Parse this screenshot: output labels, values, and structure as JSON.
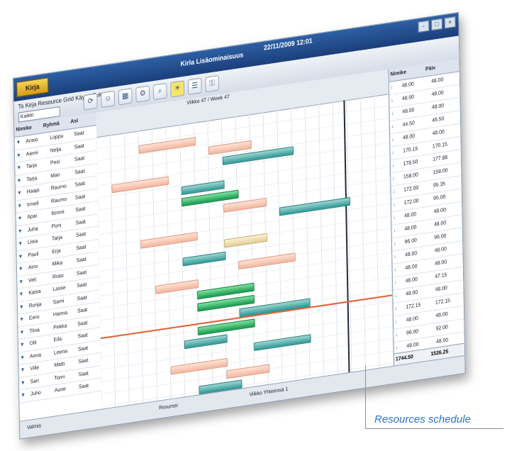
{
  "app": {
    "title": "Kirla Lisäominaisuus",
    "datetime": "22/11/2009 12:01",
    "logo_text": "Kirja",
    "window_buttons": [
      "-",
      "□",
      "×"
    ]
  },
  "toolbar": {
    "menu_text": "Ts Kirja Resource Grid Käyttö Tulos",
    "combo_value": "Kaikki",
    "icons": [
      "refresh-icon",
      "users-icon",
      "calendar-icon",
      "settings-icon",
      "search-icon",
      "sun-icon",
      "list-icon",
      "key-icon"
    ]
  },
  "left_pane": {
    "headers": [
      "Nimike",
      "Ryhmä",
      "Asi"
    ],
    "rows": [
      [
        "Ansio",
        "Loppu",
        "Saat"
      ],
      [
        "Aiemi",
        "Nelja",
        "Saat"
      ],
      [
        "Tarja",
        "Pesi",
        "Saat"
      ],
      [
        "Tarja",
        "Mari",
        "Saat"
      ],
      [
        "Haapi",
        "Raumo",
        "Saat"
      ],
      [
        "Irmeli",
        "Raumo",
        "Saat"
      ],
      [
        "Apai",
        "Ilomni",
        "Saat"
      ],
      [
        "Juha",
        "Poni",
        "Saat"
      ],
      [
        "Liisa",
        "Tarja",
        "Saat"
      ],
      [
        "Pauli",
        "Erja",
        "Saat"
      ],
      [
        "Aino",
        "Mika",
        "Saat"
      ],
      [
        "Veli",
        "Risto",
        "Saat"
      ],
      [
        "Kaisa",
        "Lasse",
        "Saat"
      ],
      [
        "Ronja",
        "Sami",
        "Saat"
      ],
      [
        "Eero",
        "Hanna",
        "Saat"
      ],
      [
        "Tiina",
        "Pekka",
        "Saat"
      ],
      [
        "Olli",
        "Eila",
        "Saat"
      ],
      [
        "Anna",
        "Leena",
        "Saat"
      ],
      [
        "Ville",
        "Matti",
        "Saat"
      ],
      [
        "Sari",
        "Tomi",
        "Saat"
      ],
      [
        "Juho",
        "Aune",
        "Saat"
      ]
    ]
  },
  "schedule": {
    "header_title": "Viikko 47 / Week 47",
    "bars": [
      {
        "color": "pink",
        "row": 1,
        "start": 3,
        "len": 4
      },
      {
        "color": "pink",
        "row": 2,
        "start": 8,
        "len": 3
      },
      {
        "color": "teal",
        "row": 3,
        "start": 9,
        "len": 5
      },
      {
        "color": "pink",
        "row": 4,
        "start": 1,
        "len": 4
      },
      {
        "color": "teal",
        "row": 5,
        "start": 6,
        "len": 3
      },
      {
        "color": "green",
        "row": 6,
        "start": 6,
        "len": 4
      },
      {
        "color": "pink",
        "row": 7,
        "start": 9,
        "len": 3
      },
      {
        "color": "teal",
        "row": 8,
        "start": 13,
        "len": 5
      },
      {
        "color": "pink",
        "row": 9,
        "start": 3,
        "len": 4
      },
      {
        "color": "tan",
        "row": 10,
        "start": 9,
        "len": 3
      },
      {
        "color": "teal",
        "row": 11,
        "start": 6,
        "len": 3
      },
      {
        "color": "pink",
        "row": 12,
        "start": 10,
        "len": 4
      },
      {
        "color": "pink",
        "row": 13,
        "start": 4,
        "len": 3
      },
      {
        "color": "green",
        "row": 14,
        "start": 7,
        "len": 4
      },
      {
        "color": "green",
        "row": 15,
        "start": 7,
        "len": 4
      },
      {
        "color": "teal",
        "row": 16,
        "start": 10,
        "len": 5
      },
      {
        "color": "green",
        "row": 17,
        "start": 7,
        "len": 4
      },
      {
        "color": "teal",
        "row": 18,
        "start": 6,
        "len": 3
      },
      {
        "color": "teal",
        "row": 19,
        "start": 11,
        "len": 4
      },
      {
        "color": "pink",
        "row": 20,
        "start": 5,
        "len": 4
      },
      {
        "color": "pink",
        "row": 21,
        "start": 9,
        "len": 3
      },
      {
        "color": "teal",
        "row": 22,
        "start": 7,
        "len": 3
      },
      {
        "color": "tan",
        "row": 23,
        "start": 2,
        "len": 4
      },
      {
        "color": "pink",
        "row": 24,
        "start": 10,
        "len": 3
      },
      {
        "color": "teal",
        "row": 25,
        "start": 4,
        "len": 3
      },
      {
        "color": "tan",
        "row": 26,
        "start": 8,
        "len": 5
      },
      {
        "color": "teal",
        "row": 27,
        "start": 12,
        "len": 4
      }
    ]
  },
  "right_pane": {
    "headers": [
      "Nimike",
      "Päiv"
    ],
    "rows": [
      [
        "48.00",
        "48.00"
      ],
      [
        "48.00",
        "48.00"
      ],
      [
        "48.00",
        "48.00"
      ],
      [
        "44.50",
        "46.50"
      ],
      [
        "48.00",
        "48.00"
      ],
      [
        "170.15",
        "170.15"
      ],
      [
        "178.50",
        "177.88"
      ],
      [
        "158.00",
        "158.00"
      ],
      [
        "172.00",
        "95.35"
      ],
      [
        "172.00",
        "95.00"
      ],
      [
        "48.00",
        "48.00"
      ],
      [
        "48.00",
        "48.00"
      ],
      [
        "96.00",
        "96.00"
      ],
      [
        "48.00",
        "48.00"
      ],
      [
        "48.00",
        "48.00"
      ],
      [
        "48.00",
        "47.15"
      ],
      [
        "48.00",
        "48.00"
      ],
      [
        "172.15",
        "172.15"
      ],
      [
        "48.00",
        "48.00"
      ],
      [
        "96.00",
        "92.00"
      ],
      [
        "48.00",
        "48.00"
      ]
    ],
    "totals": [
      "1744.50",
      "1526.25"
    ]
  },
  "status_bar": {
    "left": "Valmis",
    "mid": "Resurssi",
    "right": "Viikko Yhteensä 1"
  },
  "callout_label": "Resources schedule",
  "colors": {
    "titlebar": "#2d5fa5",
    "pink_bar": "#f3b79f",
    "teal_bar": "#2f9a97",
    "green_bar": "#179a4f",
    "today_line": "#202833",
    "now_line": "#e2663b"
  }
}
